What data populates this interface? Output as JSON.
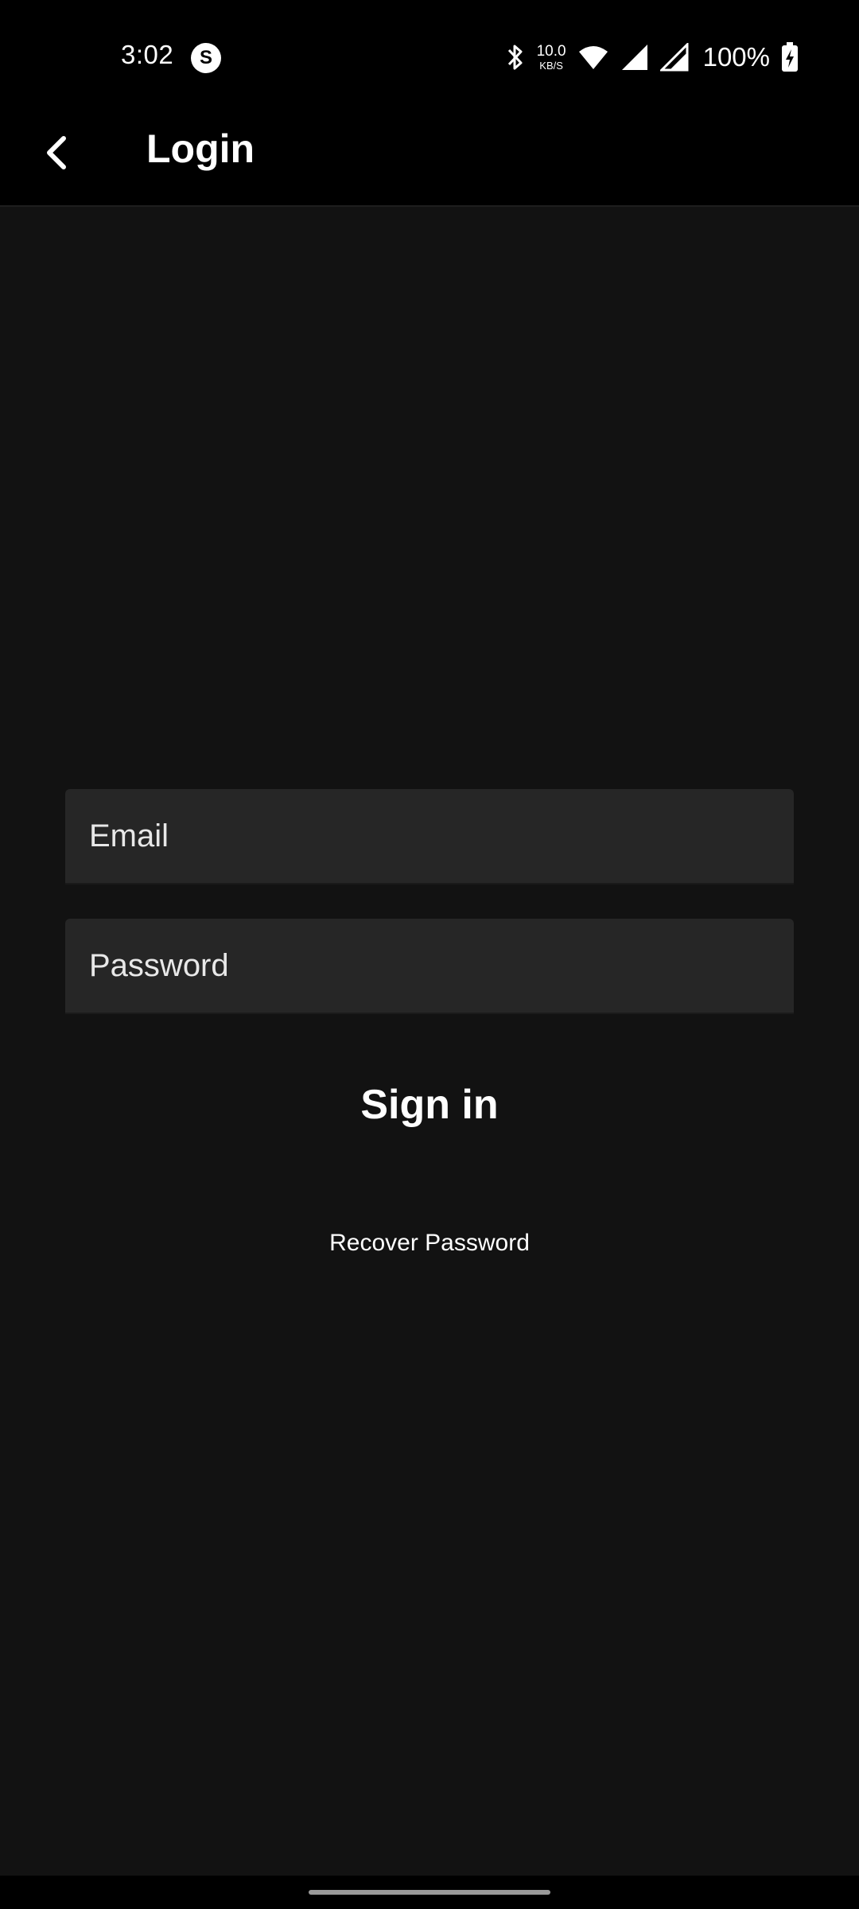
{
  "status_bar": {
    "time": "3:02",
    "app_icon_glyph": "S",
    "net_speed_value": "10.0",
    "net_speed_unit": "KB/S",
    "battery_percent": "100%",
    "icons": [
      "bluetooth-icon",
      "wifi-icon",
      "signal-icon",
      "signal-icon",
      "battery-charging-icon"
    ]
  },
  "app_bar": {
    "title": "Login",
    "back_icon": "chevron-left-icon"
  },
  "form": {
    "email": {
      "value": "",
      "placeholder": "Email"
    },
    "password": {
      "value": "",
      "placeholder": "Password"
    },
    "sign_in_label": "Sign in",
    "recover_label": "Recover Password"
  },
  "colors": {
    "background": "#121212",
    "bar_background": "#000000",
    "field_background": "#262626",
    "text": "#ffffff"
  }
}
